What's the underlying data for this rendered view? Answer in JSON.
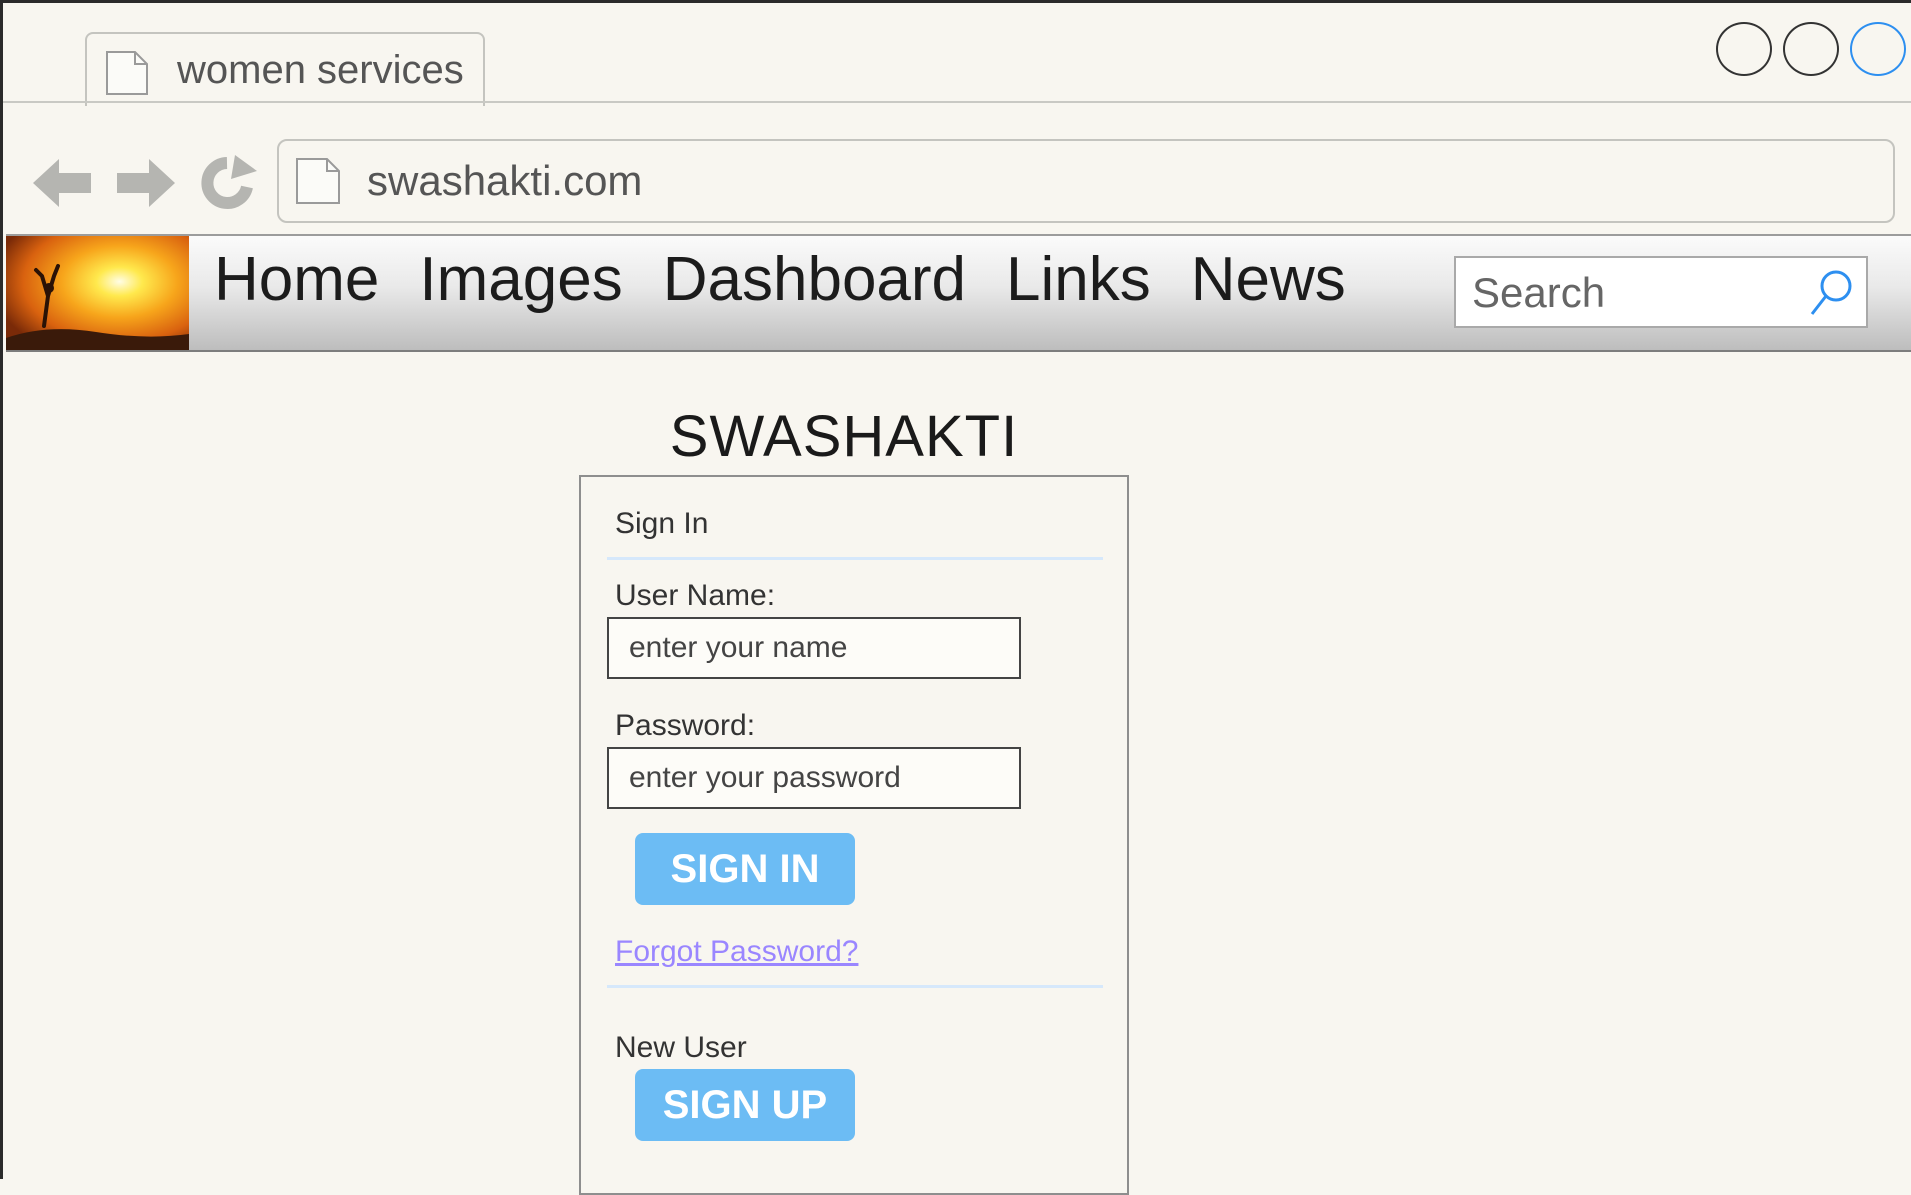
{
  "browser": {
    "tab_title": "women services",
    "url": "swashakti.com"
  },
  "nav": {
    "items": [
      "Home",
      "Images",
      "Dashboard",
      "Links",
      "News"
    ],
    "search_placeholder": "Search"
  },
  "main": {
    "brand_title": "SWASHAKTI",
    "signin": {
      "heading": "Sign In",
      "username_label": "User Name:",
      "username_placeholder": "enter your name",
      "password_label": "Password:",
      "password_placeholder": "enter your password",
      "signin_button": "SIGN IN",
      "forgot_link": "Forgot Password?",
      "new_user_label": "New User",
      "signup_button": "SIGN UP"
    }
  },
  "colors": {
    "page_bg": "#f8f6f0",
    "button_blue": "#6cbcf4",
    "link_purple": "#9a86ff",
    "accent_blue": "#2d8ff0"
  },
  "icons": [
    "page-icon",
    "back-arrow-icon",
    "forward-arrow-icon",
    "reload-icon",
    "search-icon",
    "window-button"
  ]
}
